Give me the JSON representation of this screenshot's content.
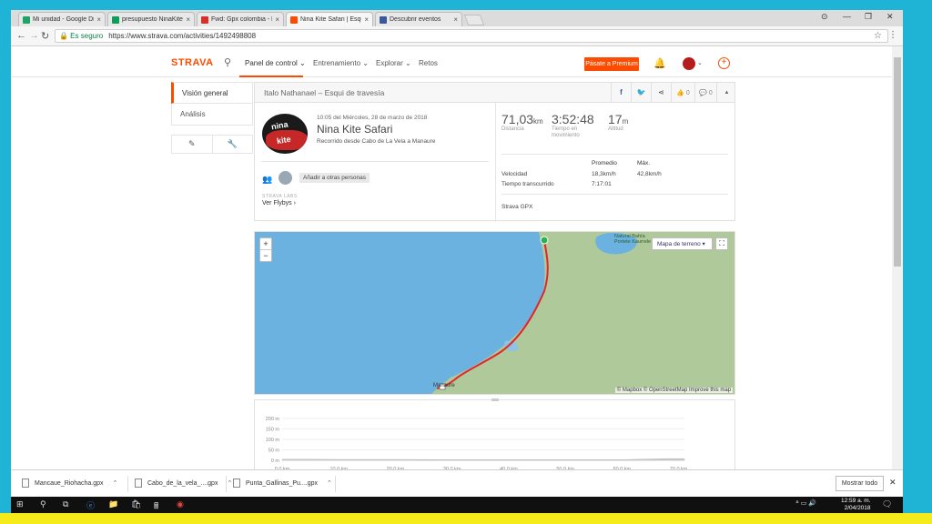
{
  "browser": {
    "tabs": [
      {
        "label": "Mi unidad - Google Drive",
        "color": "#1fa463"
      },
      {
        "label": "presupuesto NinaKite Safari",
        "color": "#0f9d58"
      },
      {
        "label": "Fwd: Gpx colombia - hotmail",
        "color": "#d93025"
      },
      {
        "label": "Nina Kite Safari | Esqui de travesia",
        "color": "#fc4c02"
      },
      {
        "label": "Descubrir eventos",
        "color": "#3b5998"
      }
    ],
    "close_glyph": "×",
    "window_controls": [
      "⊙",
      "—",
      "❐",
      "✕"
    ],
    "nav": {
      "back": "←",
      "forward": "→",
      "reload": "↻"
    },
    "secure_label": "🔒 Es seguro",
    "url": "https://www.strava.com/activities/1492498808",
    "star": "☆",
    "menu": "⋮"
  },
  "strava": {
    "logo": "STRAVA",
    "search_glyph": "⚲",
    "nav": [
      {
        "label": "Panel de control ⌄"
      },
      {
        "label": "Entrenamiento ⌄"
      },
      {
        "label": "Explorar ⌄"
      },
      {
        "label": "Retos"
      }
    ],
    "premium_label": "Pásate a Premium",
    "bell": "🔔",
    "avatar_chev": "⌄",
    "plus": "+"
  },
  "sidebar": {
    "items": [
      {
        "label": "Visión general"
      },
      {
        "label": "Análisis"
      }
    ],
    "tools": [
      "✎",
      "🔧"
    ]
  },
  "activity": {
    "header_title": "Italo Nathanael – Esqui de travesía",
    "share": {
      "fb": "f",
      "tw": "🐦",
      "share": "⋖",
      "kudos": "👍 0",
      "comments": "💬 0",
      "collapse": "▲"
    },
    "logo_text_1": "nina",
    "logo_text_2": "kite",
    "date": "10:05 del Miércoles, 28 de marzo de 2018",
    "name": "Nina Kite Safari",
    "description": "Recorrido desde Cabo de La Vela a Manaure",
    "people_icon": "👥",
    "add_people": "Añadir a otras personas",
    "labs": "STRAVA LABS",
    "flyby": "Ver Flybys ›",
    "stats": [
      {
        "value": "71,03",
        "unit": "km",
        "label": "Distancia"
      },
      {
        "value": "3:52:48",
        "unit": "",
        "label": "Tiempo en movimiento"
      },
      {
        "value": "17",
        "unit": "m",
        "label": "Altitud"
      }
    ],
    "table": {
      "head_avg": "Promedio",
      "head_max": "Máx.",
      "speed_label": "Velocidad",
      "speed_avg": "18,3km/h",
      "speed_max": "42,8km/h",
      "elapsed_label": "Tiempo transcurrido",
      "elapsed_avg": "7:17:01"
    },
    "device": "Strava GPX"
  },
  "map": {
    "zoom_in": "+",
    "zoom_out": "−",
    "map_type": "Mapa de terreno ▾",
    "fullscreen": "⛶",
    "park_name_1": "Natural Bahía",
    "park_name_2": "Portete Kaurrele",
    "town": "Manaure",
    "attribution": "© Mapbox © OpenStreetMap Improve this map",
    "colors": {
      "sea": "#6cb2e0",
      "land": "#b0c99b",
      "route": "#e3262b",
      "start": "#2bb24c"
    }
  },
  "chart_data": {
    "type": "area",
    "title": "",
    "xlabel": "",
    "ylabel": "",
    "x_ticks": [
      "0,0 km",
      "10,0 km",
      "20,0 km",
      "30,0 km",
      "40,0 km",
      "50,0 km",
      "60,0 km",
      "70,0 km"
    ],
    "y_ticks": [
      "200 m",
      "150 m",
      "100 m",
      "50 m",
      "0 m"
    ],
    "xlim": [
      0,
      71.03
    ],
    "ylim": [
      0,
      200
    ],
    "x": [
      0,
      5,
      10,
      20,
      30,
      40,
      50,
      60,
      65,
      68,
      71.03
    ],
    "y": [
      5,
      5,
      4,
      4,
      3,
      3,
      3,
      3,
      6,
      8,
      8
    ],
    "color": "#cccccc"
  },
  "downloads": {
    "files": [
      {
        "name": "Mancaue_Riohacha.gpx"
      },
      {
        "name": "Cabo_de_la_vela_....gpx"
      },
      {
        "name": "Punta_Gallinas_Pu....gpx"
      }
    ],
    "chev": "⌃",
    "show_all": "Mostrar todo",
    "close": "✕"
  },
  "taskbar": {
    "icons": [
      "⊞",
      "⚲",
      "⧉",
      "ⓔ",
      "📁",
      "🛍",
      "🖩",
      "◉"
    ],
    "tray": "ᐞ ▭ 🔊",
    "time": "12:59 a. m.",
    "date": "2/04/2018",
    "notif": "🗨"
  }
}
